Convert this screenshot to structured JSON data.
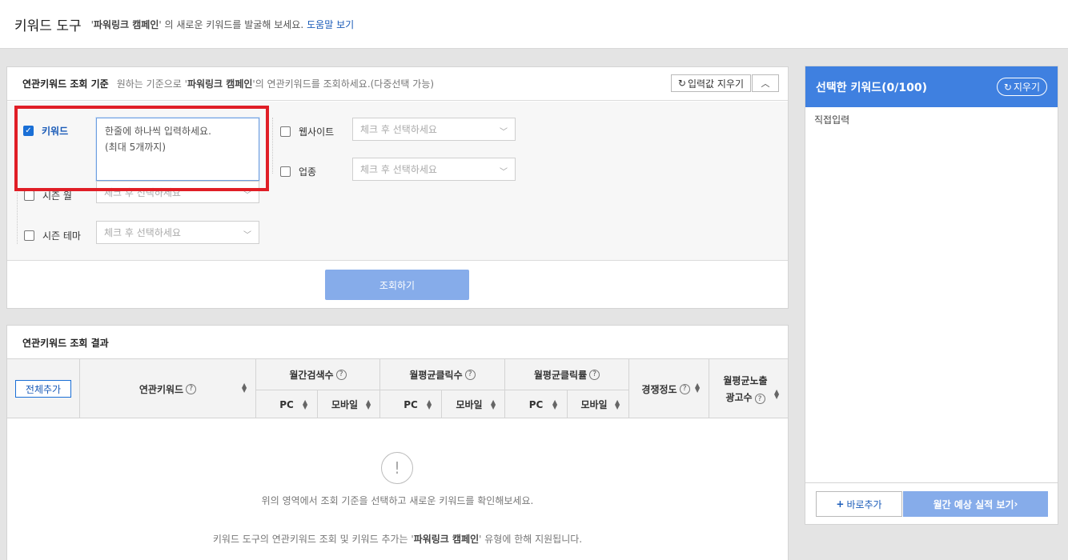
{
  "header": {
    "title": "키워드 도구",
    "desc_pre": "'",
    "desc_campaign": "파워링크 캠페인",
    "desc_post": "' 의 새로운 키워드를 발굴해 보세요.",
    "help_link": "도움말 보기"
  },
  "criteria": {
    "title": "연관키워드 조회 기준",
    "desc_pre": "원하는 기준으로 '",
    "desc_campaign": "파워링크 캠페인",
    "desc_post": "'의 연관키워드를 조회하세요.(다중선택 가능)",
    "clear_label": "입력값 지우기",
    "collapse_icon": "chevron-up-icon",
    "keyword": {
      "label": "키워드",
      "checked": true,
      "textarea_line1": "한줄에 하나씩 입력하세요.",
      "textarea_line2": "(최대 5개까지)"
    },
    "website": {
      "label": "웹사이트",
      "placeholder": "체크 후 선택하세요"
    },
    "industry": {
      "label": "업종",
      "placeholder": "체크 후 선택하세요"
    },
    "season_month": {
      "label": "시즌 월",
      "placeholder": "체크 후 선택하세요"
    },
    "season_theme": {
      "label": "시즌 테마",
      "placeholder": "체크 후 선택하세요"
    },
    "search_button": "조회하기"
  },
  "results": {
    "title": "연관키워드 조회 결과",
    "add_all": "전체추가",
    "columns": {
      "keyword": "연관키워드",
      "monthly_search": "월간검색수",
      "avg_clicks": "월평균클릭수",
      "avg_ctr": "월평균클릭률",
      "competition": "경쟁정도",
      "avg_ads_line1": "월평균노출",
      "avg_ads_line2": "광고수",
      "pc": "PC",
      "mobile": "모바일"
    },
    "empty_icon": "!",
    "empty_msg": "위의 영역에서 조회 기준을 선택하고 새로운 키워드를 확인해보세요.",
    "note_pre": "키워드 도구의 연관키워드 조회 및 키워드 추가는 '",
    "note_campaign": "파워링크 캠페인",
    "note_post": "' 유형에 한해 지원됩니다."
  },
  "selected": {
    "title": "선택한 키워드(0/100)",
    "reset_label": "지우기",
    "direct_input": "직접입력",
    "quick_add": "바로추가",
    "forecast": "월간 예상 실적 보기"
  }
}
